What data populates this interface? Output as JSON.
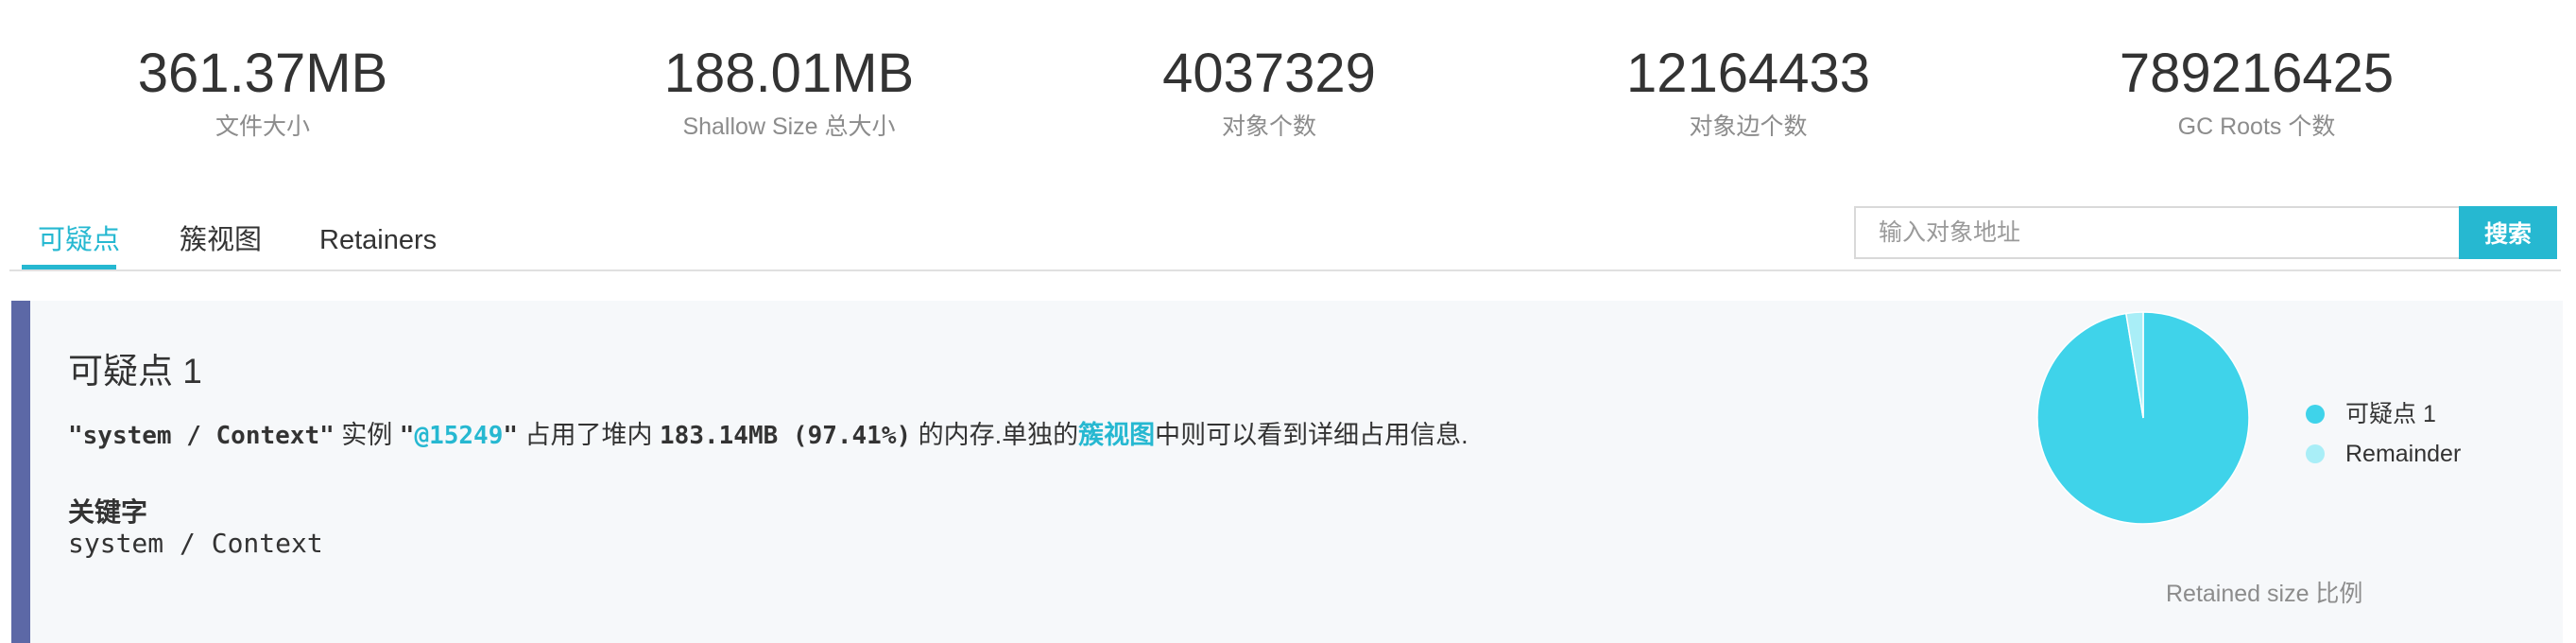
{
  "stats": [
    {
      "value": "361.37MB",
      "label": "文件大小"
    },
    {
      "value": "188.01MB",
      "label": "Shallow Size 总大小"
    },
    {
      "value": "4037329",
      "label": "对象个数"
    },
    {
      "value": "12164433",
      "label": "对象边个数"
    },
    {
      "value": "789216425",
      "label": "GC Roots 个数"
    }
  ],
  "tabs": [
    "可疑点",
    "簇视图",
    "Retainers"
  ],
  "search": {
    "placeholder": "输入对象地址",
    "button": "搜索"
  },
  "suspect": {
    "title": "可疑点 1",
    "name_quoted": "\"system / Context\"",
    "instance_text": " 实例 ",
    "quote_open": "\"",
    "instance_id": "@15249",
    "quote_close": "\"",
    "occupy_text": " 占用了堆内 ",
    "size_text": "183.14MB (97.41%)",
    "memory_text": " 的内存.单独的",
    "cluster_link": "簇视图",
    "tail_text": "中则可以看到详细占用信息.",
    "keyword_label": "关键字",
    "keyword_value": "system / Context"
  },
  "chart_data": {
    "type": "pie",
    "labels": [
      "可疑点 1",
      "Remainder"
    ],
    "values": [
      97.41,
      2.59
    ],
    "colors": [
      "#3fd3ea",
      "#a9eef7"
    ],
    "caption": "Retained size 比例",
    "legend_position": "right"
  }
}
